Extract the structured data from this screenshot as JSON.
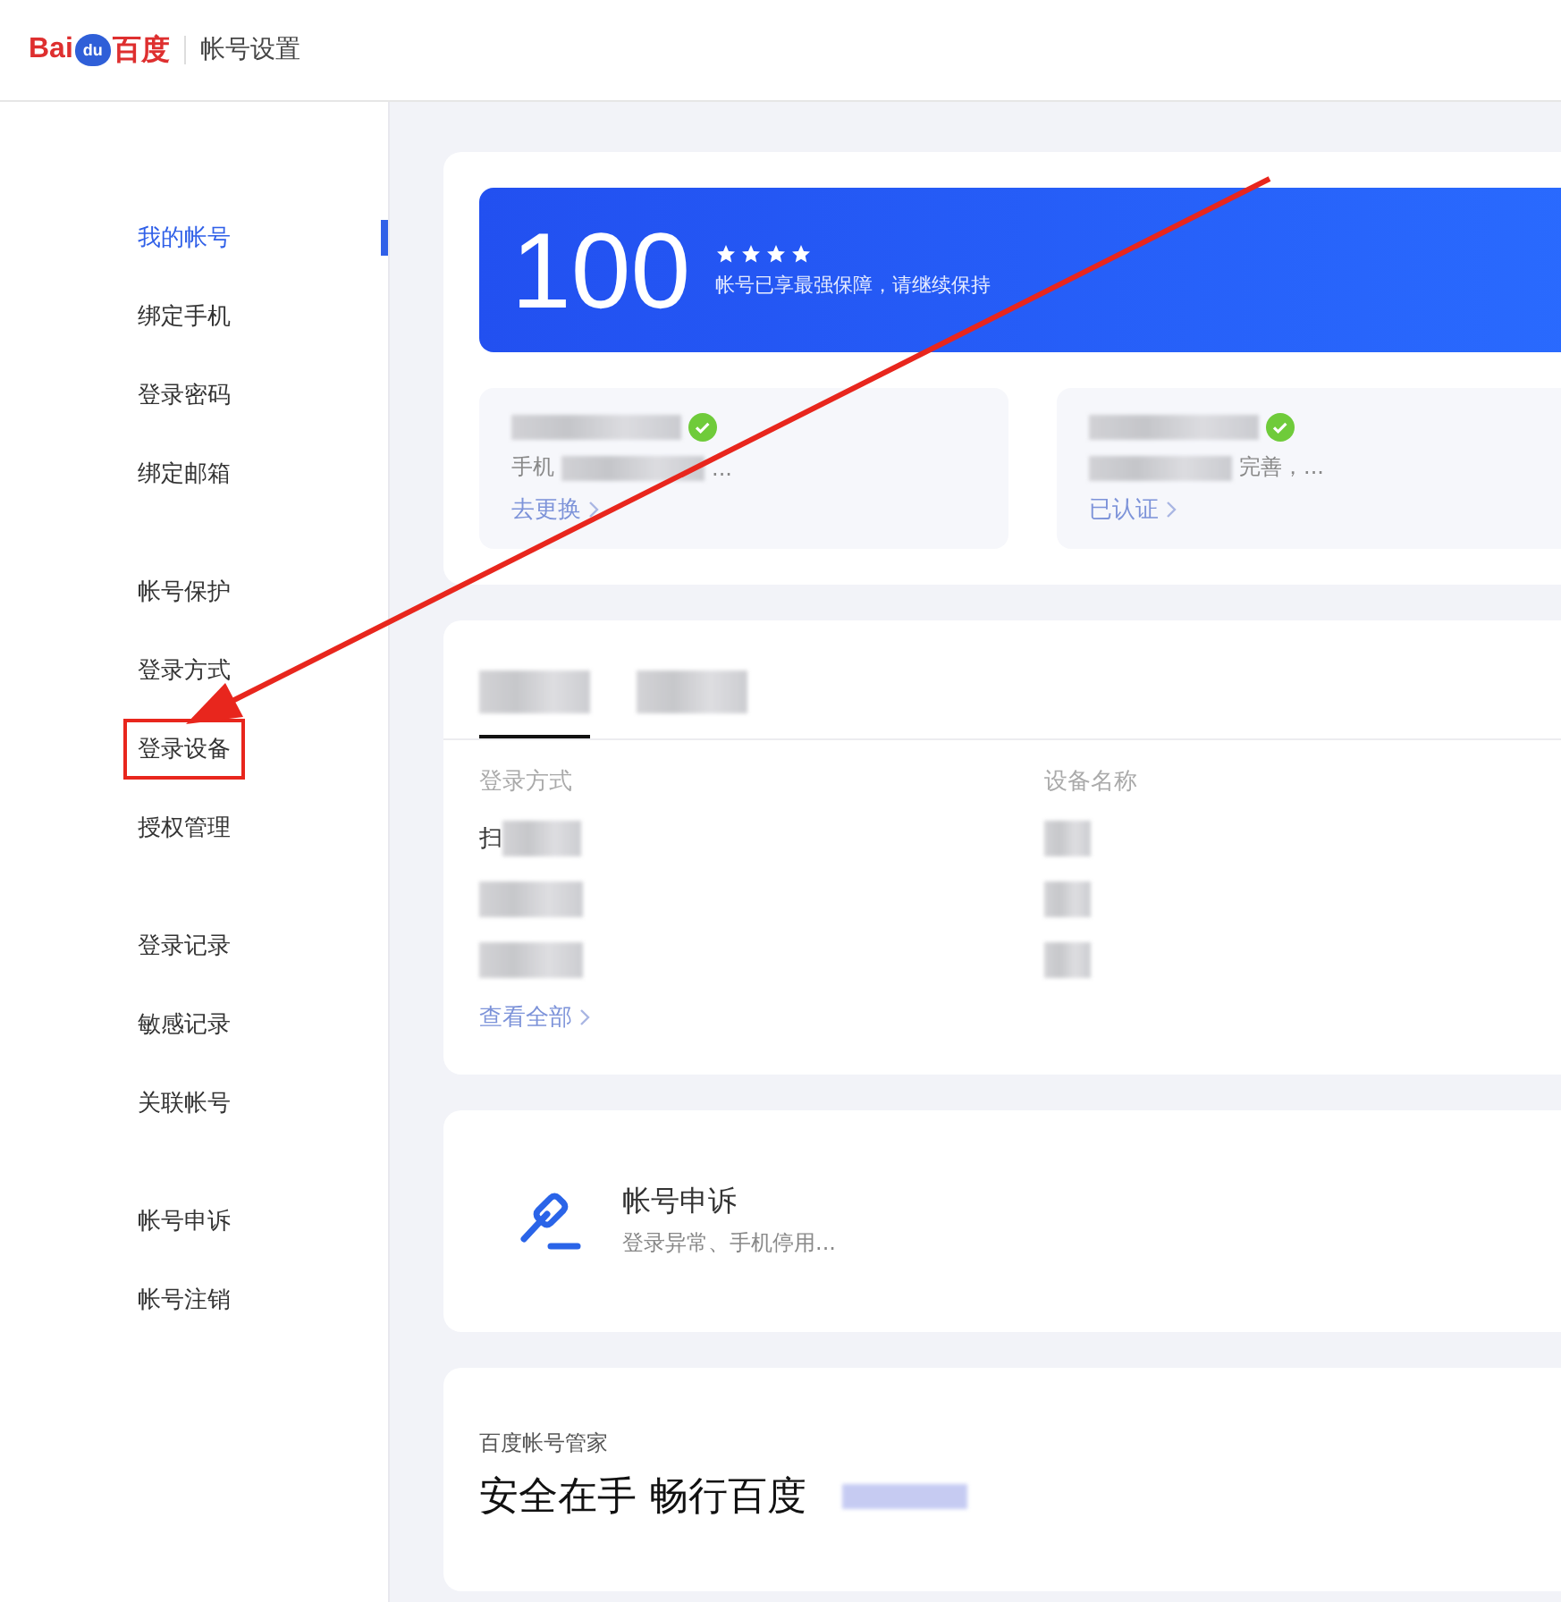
{
  "header": {
    "logo": {
      "left": "Bai",
      "paw": "du",
      "right": "百度"
    },
    "title": "帐号设置"
  },
  "sidebar": {
    "groups": [
      {
        "items": [
          {
            "label": "我的帐号",
            "selected": true,
            "highlighted": false
          },
          {
            "label": "绑定手机",
            "selected": false,
            "highlighted": false
          },
          {
            "label": "登录密码",
            "selected": false,
            "highlighted": false
          },
          {
            "label": "绑定邮箱",
            "selected": false,
            "highlighted": false
          }
        ]
      },
      {
        "items": [
          {
            "label": "帐号保护",
            "selected": false,
            "highlighted": false
          },
          {
            "label": "登录方式",
            "selected": false,
            "highlighted": false
          },
          {
            "label": "登录设备",
            "selected": false,
            "highlighted": true
          },
          {
            "label": "授权管理",
            "selected": false,
            "highlighted": false
          }
        ]
      },
      {
        "items": [
          {
            "label": "登录记录",
            "selected": false,
            "highlighted": false
          },
          {
            "label": "敏感记录",
            "selected": false,
            "highlighted": false
          },
          {
            "label": "关联帐号",
            "selected": false,
            "highlighted": false
          }
        ]
      },
      {
        "items": [
          {
            "label": "帐号申诉",
            "selected": false,
            "highlighted": false
          },
          {
            "label": "帐号注销",
            "selected": false,
            "highlighted": false
          }
        ]
      }
    ]
  },
  "score": {
    "value": "100",
    "stars": 4,
    "message": "帐号已享最强保障，请继续保持"
  },
  "info_cards": [
    {
      "verified": true,
      "line_lead": "手机",
      "line_tail": "...",
      "link": "去更换"
    },
    {
      "verified": true,
      "line_tail": "完善，...",
      "link": "已认证"
    }
  ],
  "devices": {
    "tabs": [
      {
        "selected": true
      },
      {
        "selected": false
      }
    ],
    "columns": [
      "登录方式",
      "设备名称"
    ],
    "rows": [
      {
        "kind": "partial",
        "method": "扫"
      },
      {
        "kind": "redacted"
      },
      {
        "kind": "redacted"
      }
    ],
    "link": "查看全部"
  },
  "appeal": {
    "title": "帐号申诉",
    "subtitle": "登录异常、手机停用..."
  },
  "promo": {
    "label": "百度帐号管家",
    "headline": "安全在手 畅行百度"
  },
  "annotation": {
    "arrow": true
  }
}
